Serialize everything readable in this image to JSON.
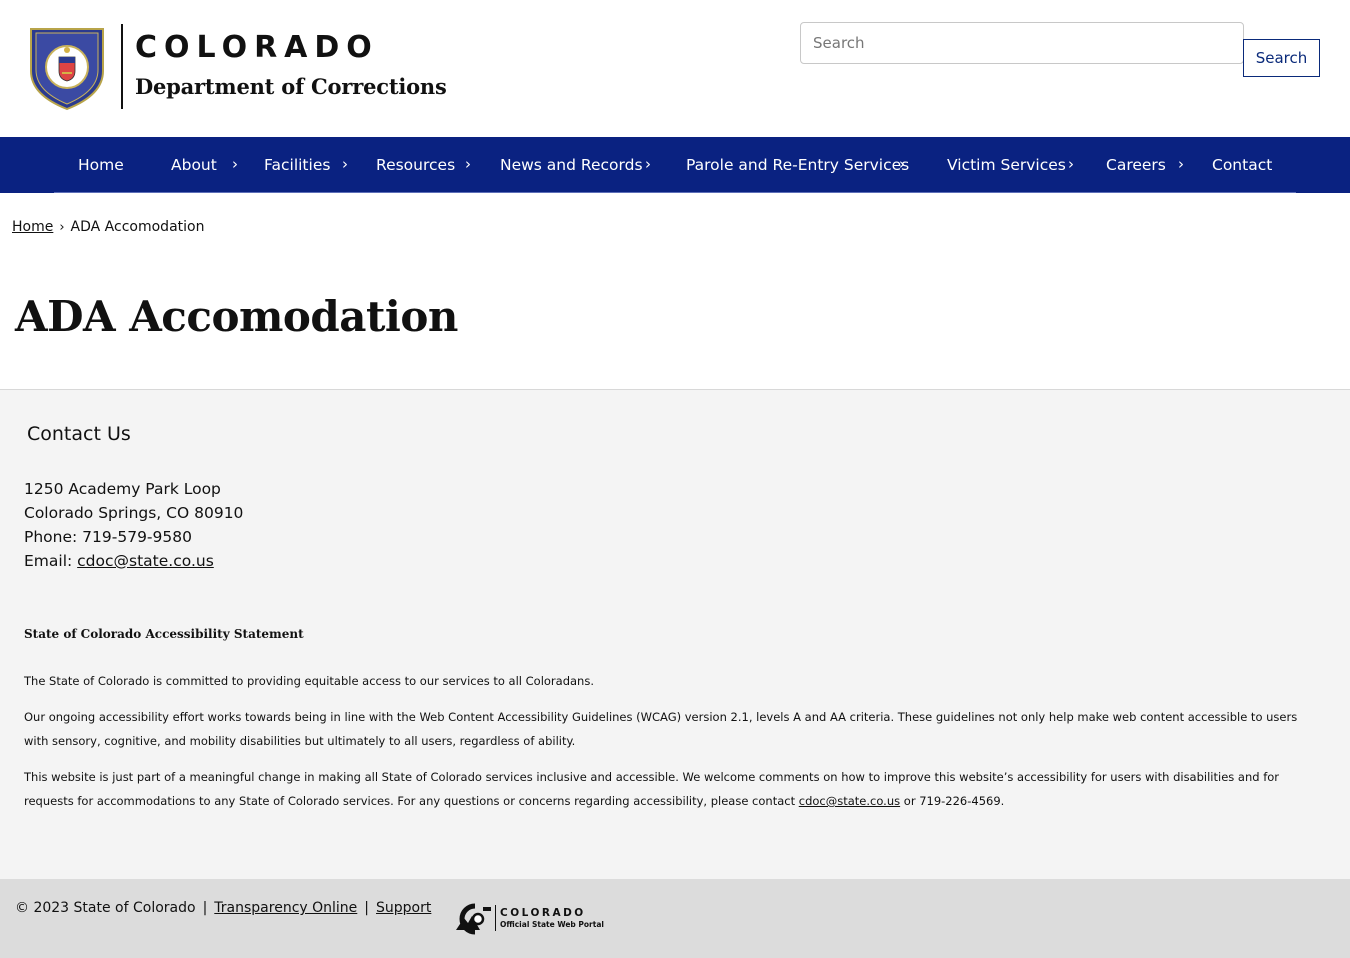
{
  "header": {
    "logo_state": "COLORADO",
    "logo_dept": "Department of Corrections",
    "search_placeholder": "Search",
    "search_button": "Search"
  },
  "nav": {
    "items": [
      {
        "label": "Home",
        "has_submenu": false
      },
      {
        "label": "About",
        "has_submenu": true
      },
      {
        "label": "Facilities",
        "has_submenu": true
      },
      {
        "label": "Resources",
        "has_submenu": true
      },
      {
        "label": "News and Records",
        "has_submenu": true
      },
      {
        "label": "Parole and Re-Entry Services",
        "has_submenu": true
      },
      {
        "label": "Victim Services",
        "has_submenu": true
      },
      {
        "label": "Careers",
        "has_submenu": true
      },
      {
        "label": "Contact",
        "has_submenu": false
      }
    ],
    "chevron_icon": "chevron-right-icon"
  },
  "breadcrumb": {
    "home": "Home",
    "current": "ADA Accomodation"
  },
  "page": {
    "title": "ADA Accomodation"
  },
  "contact": {
    "heading": "Contact Us",
    "address_line1": "1250 Academy Park Loop",
    "address_line2": "Colorado Springs, CO 80910",
    "phone": "Phone: 719-579-9580",
    "email_label": "Email: ",
    "email": "cdoc@state.co.us"
  },
  "accessibility": {
    "title": "State of Colorado Accessibility Statement",
    "p1": "The State of Colorado is committed to providing equitable access to our services to all Coloradans.",
    "p2": "Our ongoing accessibility effort works towards being in line with the Web Content Accessibility Guidelines (WCAG) version 2.1, levels A and AA criteria. These guidelines not only help make web content accessible to users with sensory, cognitive, and mobility disabilities but ultimately to all users, regardless of ability.",
    "p3_before": "This website is just part of a meaningful change in making all State of Colorado services inclusive and accessible. We welcome comments on how to improve this website’s accessibility for users with disabilities and for requests for accommodations to any State of Colorado services. For any questions or concerns regarding accessibility, please contact ",
    "p3_email": "cdoc@state.co.us",
    "p3_after": " or 719-226-4569."
  },
  "footer": {
    "copyright": "© 2023 State of Colorado",
    "pipe": "|",
    "transparency": "Transparency Online",
    "support": "Support",
    "portal_name": "COLORADO",
    "portal_sub": "Official State Web Portal"
  },
  "colors": {
    "nav_bg": "#0a2281",
    "section_bg": "#f4f4f4",
    "footer_bg": "#dcdcdc"
  }
}
